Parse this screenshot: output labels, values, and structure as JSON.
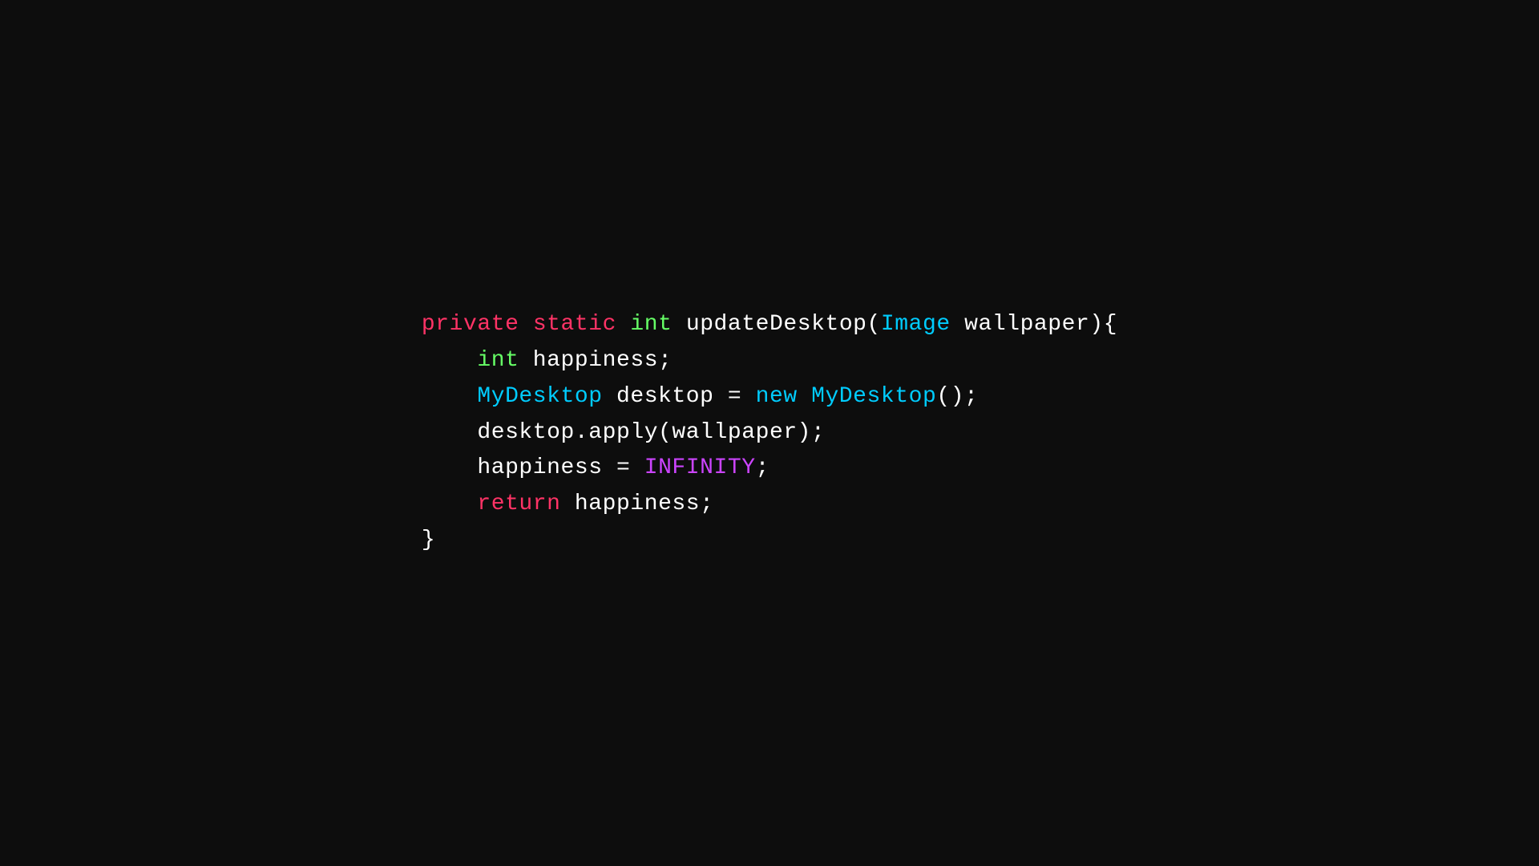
{
  "code": {
    "lines": [
      {
        "id": "line1",
        "parts": [
          {
            "text": "private",
            "cls": "kw-private"
          },
          {
            "text": " ",
            "cls": "plain"
          },
          {
            "text": "static",
            "cls": "kw-static"
          },
          {
            "text": " ",
            "cls": "plain"
          },
          {
            "text": "int",
            "cls": "kw-int"
          },
          {
            "text": " updateDesktop(",
            "cls": "plain"
          },
          {
            "text": "Image",
            "cls": "class-image"
          },
          {
            "text": " wallpaper){",
            "cls": "plain"
          }
        ]
      },
      {
        "id": "line2",
        "indent": true,
        "parts": [
          {
            "text": "    ",
            "cls": "plain"
          },
          {
            "text": "int",
            "cls": "kw-int"
          },
          {
            "text": " happiness;",
            "cls": "plain"
          }
        ]
      },
      {
        "id": "line3",
        "indent": true,
        "parts": [
          {
            "text": "    ",
            "cls": "plain"
          },
          {
            "text": "MyDesktop",
            "cls": "class-name"
          },
          {
            "text": " desktop = ",
            "cls": "plain"
          },
          {
            "text": "new",
            "cls": "kw-new"
          },
          {
            "text": " ",
            "cls": "plain"
          },
          {
            "text": "MyDesktop",
            "cls": "class-name"
          },
          {
            "text": "();",
            "cls": "plain"
          }
        ]
      },
      {
        "id": "line4",
        "indent": true,
        "parts": [
          {
            "text": "    desktop.apply(wallpaper);",
            "cls": "plain"
          }
        ]
      },
      {
        "id": "line5",
        "indent": true,
        "parts": [
          {
            "text": "    happiness = ",
            "cls": "plain"
          },
          {
            "text": "INFINITY",
            "cls": "constant"
          },
          {
            "text": ";",
            "cls": "plain"
          }
        ]
      },
      {
        "id": "line6",
        "indent": true,
        "parts": [
          {
            "text": "    ",
            "cls": "plain"
          },
          {
            "text": "return",
            "cls": "kw-return"
          },
          {
            "text": " happiness;",
            "cls": "plain"
          }
        ]
      },
      {
        "id": "line7",
        "parts": [
          {
            "text": "}",
            "cls": "plain"
          }
        ]
      }
    ]
  }
}
